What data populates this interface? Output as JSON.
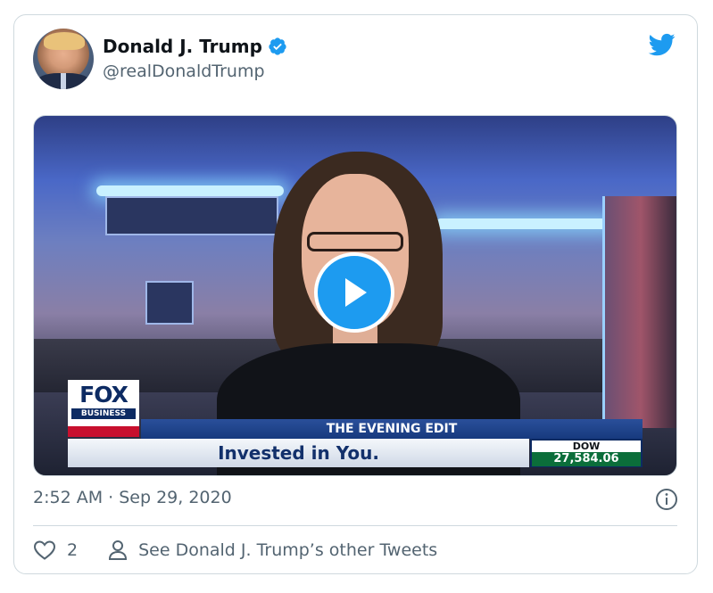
{
  "tweet": {
    "author": {
      "display_name": "Donald J. Trump",
      "handle": "@realDonaldTrump",
      "verified": true
    },
    "timestamp": "2:52 AM · Sep 29, 2020",
    "likes_count": "2",
    "other_tweets_label": "See Donald J. Trump’s other Tweets"
  },
  "video": {
    "network_logo": "FOX",
    "network_sub": "BUSINESS",
    "show_title": "THE EVENING EDIT",
    "headline": "Invested in You.",
    "ticker": {
      "label": "DOW",
      "value": "27,584.06"
    }
  },
  "icons": {
    "verified": "verified-badge-icon",
    "brand": "twitter-bird-icon",
    "play": "play-icon",
    "info": "info-icon",
    "like": "heart-icon",
    "profile": "person-icon"
  },
  "colors": {
    "accent": "#1d9bf0",
    "text_primary": "#0f1419",
    "text_secondary": "#536471",
    "border": "#cfd9de"
  }
}
